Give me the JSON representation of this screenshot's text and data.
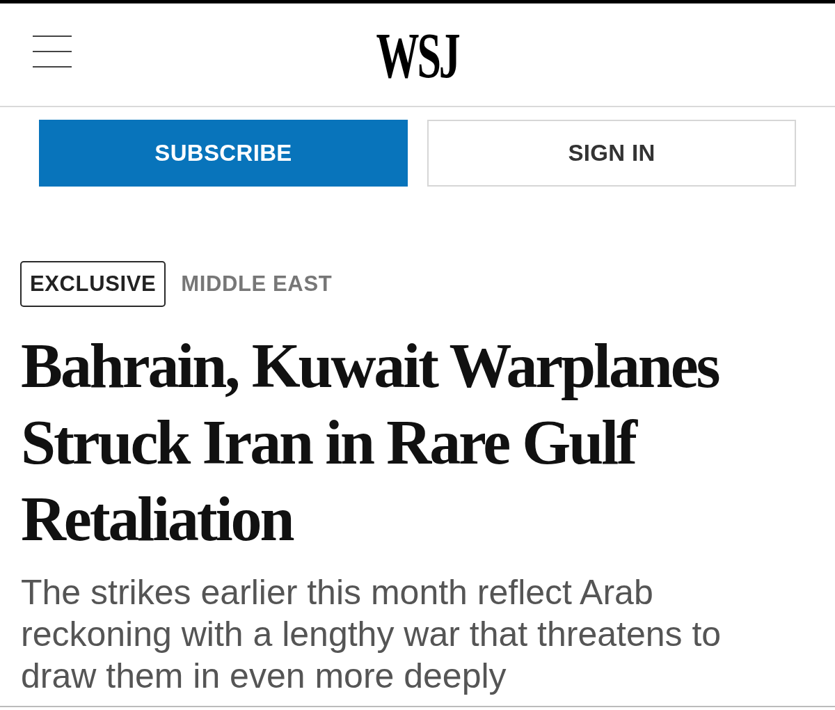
{
  "header": {
    "logo": "WSJ"
  },
  "actions": [
    {
      "label": "SUBSCRIBE",
      "kind": "primary"
    },
    {
      "label": "SIGN IN",
      "kind": "secondary"
    }
  ],
  "article": {
    "labels": [
      {
        "text": "EXCLUSIVE",
        "kind": "boxed"
      },
      {
        "text": "MIDDLE EAST",
        "kind": "section"
      }
    ],
    "headline": "Bahrain, Kuwait Warplanes Struck Iran in Rare Gulf Retaliation",
    "dek": "The strikes earlier this month reflect Arab reckoning with a lengthy war that threatens to draw them in even more deeply"
  }
}
